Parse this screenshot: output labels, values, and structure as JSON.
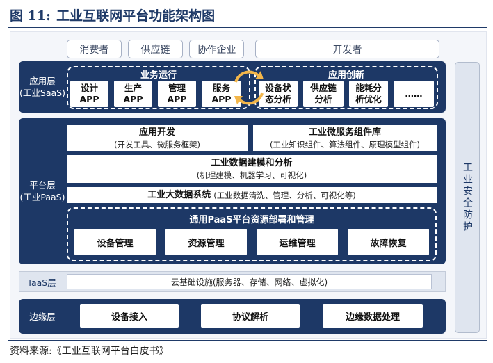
{
  "figure": {
    "number": "图 11:",
    "title": "工业互联网平台功能架构图",
    "source": "资料来源:《工业互联网平台白皮书》"
  },
  "users": {
    "consumer": "消费者",
    "supply_chain": "供应链",
    "cooperative": "协作企业",
    "developer": "开发者"
  },
  "app_layer": {
    "label_line1": "应用层",
    "label_line2": "(工业SaaS)",
    "operations": {
      "title": "业务运行",
      "items": [
        {
          "line1": "设计",
          "line2": "APP"
        },
        {
          "line1": "生产",
          "line2": "APP"
        },
        {
          "line1": "管理",
          "line2": "APP"
        },
        {
          "line1": "服务",
          "line2": "APP"
        }
      ]
    },
    "innovation": {
      "title": "应用创新",
      "items": [
        {
          "line1": "设备状",
          "line2": "态分析"
        },
        {
          "line1": "供应链",
          "line2": "分析"
        },
        {
          "line1": "能耗分",
          "line2": "析优化"
        },
        {
          "line1": "……",
          "line2": ""
        }
      ]
    }
  },
  "platform_layer": {
    "label_line1": "平台层",
    "label_line2": "(工业PaaS)",
    "app_dev": {
      "title": "应用开发",
      "sub": "(开发工具、微服务框架)"
    },
    "microservices": {
      "title": "工业微服务组件库",
      "sub": "(工业知识组件、算法组件、原理模型组件)"
    },
    "data_modeling": {
      "title": "工业数据建模和分析",
      "sub": "(机理建模、机器学习、可视化)"
    },
    "big_data": {
      "title": "工业大数据系统",
      "sub": "(工业数据清洗、管理、分析、可视化等)"
    },
    "paas_resources": {
      "title": "通用PaaS平台资源部署和管理",
      "items": [
        "设备管理",
        "资源管理",
        "运维管理",
        "故障恢复"
      ]
    }
  },
  "iaas_layer": {
    "label": "IaaS层",
    "content": "云基础设施(服务器、存储、网络、虚拟化)"
  },
  "edge_layer": {
    "label": "边缘层",
    "items": [
      "设备接入",
      "协议解析",
      "边缘数据处理"
    ]
  },
  "security": {
    "label": "工业安全防护"
  }
}
